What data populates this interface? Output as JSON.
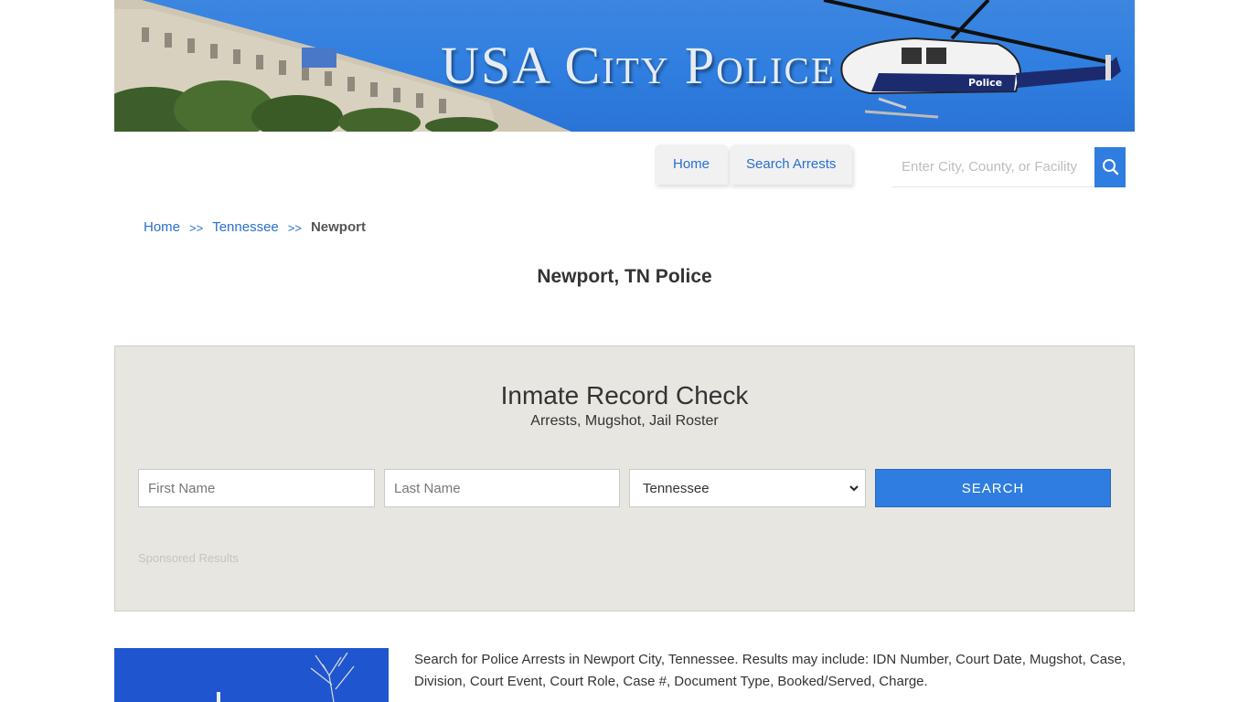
{
  "banner": {
    "site_title": "USA City Police",
    "heli_text": "Police"
  },
  "nav": {
    "home": "Home",
    "search_arrests": "Search Arrests"
  },
  "search": {
    "placeholder": "Enter City, County, or Facility"
  },
  "breadcrumb": {
    "home": "Home",
    "sep": ">>",
    "state": "Tennessee",
    "current": "Newport"
  },
  "page_title": "Newport, TN Police",
  "record_check": {
    "title": "Inmate Record Check",
    "subtitle": "Arrests, Mugshot, Jail Roster",
    "first_placeholder": "First Name",
    "last_placeholder": "Last Name",
    "state_value": "Tennessee",
    "button": "SEARCH",
    "sponsored": "Sponsored Results"
  },
  "content": {
    "description": "Search for Police Arrests in Newport City, Tennessee. Results may include: IDN Number, Court Date, Mugshot, Case, Division, Court Event, Court Role, Case #, Document Type, Booked/Served, Charge."
  },
  "colors": {
    "accent": "#2f7de0",
    "panel_bg": "#e8e6e1",
    "link": "#2a6fd0"
  }
}
